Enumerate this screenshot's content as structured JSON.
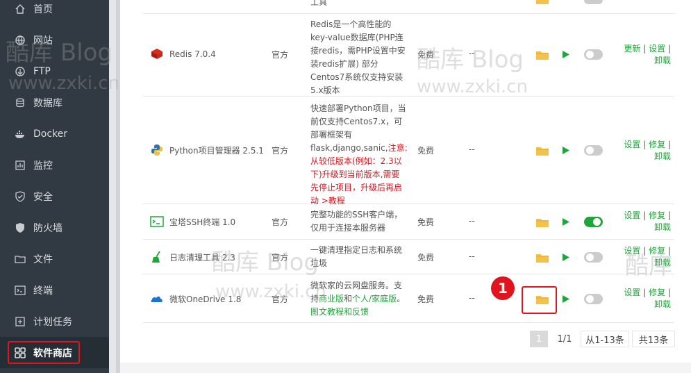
{
  "sidebar": {
    "items": [
      {
        "label": "首页",
        "icon": "home-icon"
      },
      {
        "label": "网站",
        "icon": "globe-icon"
      },
      {
        "label": "FTP",
        "icon": "ftp-icon"
      },
      {
        "label": "数据库",
        "icon": "database-icon"
      },
      {
        "label": "Docker",
        "icon": "docker-icon"
      },
      {
        "label": "监控",
        "icon": "monitor-icon"
      },
      {
        "label": "安全",
        "icon": "shield-icon"
      },
      {
        "label": "防火墙",
        "icon": "firewall-icon"
      },
      {
        "label": "文件",
        "icon": "folder-icon"
      },
      {
        "label": "终端",
        "icon": "terminal-icon"
      },
      {
        "label": "计划任务",
        "icon": "clock-icon"
      },
      {
        "label": "软件商店",
        "icon": "grid-icon"
      }
    ]
  },
  "table": {
    "top_partial": {
      "desc": "工具"
    },
    "rows": [
      {
        "name": "Redis 7.0.4",
        "developer": "官方",
        "desc_lines": [
          "Redis是一个高性能的",
          "key-value数据库(PHP连",
          "接redis，需PHP设置中安",
          "装redis扩展) 部分",
          "Centos7系统仅支持安装",
          "5.x版本"
        ],
        "price": "免费",
        "expire": "--",
        "toggle_on": false,
        "ops": [
          "更新",
          "设置",
          "卸载"
        ]
      },
      {
        "name": "Python项目管理器 2.5.1",
        "developer": "官方",
        "desc_lines": [
          "快速部署Python项目，当",
          "前仅支持Centos7.x，可",
          "部署框架有",
          "flask,django,sanic,"
        ],
        "desc_red_tail": "注意:",
        "desc_red_lines": [
          "从较低版本(例如：2.3以",
          "下)升级到当前版本,需要",
          "先停止项目，升级后再启",
          "动 >教程"
        ],
        "price": "免费",
        "expire": "--",
        "toggle_on": false,
        "ops": [
          "设置",
          "修复",
          "卸载"
        ]
      },
      {
        "name": "宝塔SSH终端 1.0",
        "developer": "官方",
        "desc_lines": [
          "完整功能的SSH客户端，",
          "仅用于连接本服务器"
        ],
        "price": "免费",
        "expire": "--",
        "toggle_on": true,
        "ops": [
          "设置",
          "修复",
          "卸载"
        ]
      },
      {
        "name": "日志清理工具 2.3",
        "developer": "官方",
        "desc_lines": [
          "一键清理指定日志和系统",
          "垃圾"
        ],
        "price": "免费",
        "expire": "--",
        "toggle_on": false,
        "ops": [
          "设置",
          "修复",
          "卸载"
        ]
      },
      {
        "name": "微软OneDrive 1.8",
        "developer": "官方",
        "desc_line1": "微软家的云网盘服务。支",
        "desc_line2_pre": "持",
        "desc_line2_g1": "商业版",
        "desc_line2_mid": "和",
        "desc_line2_g2": "个人/家庭版",
        "desc_line2_post": "。",
        "desc_line3": "图文教程和反馈",
        "price": "免费",
        "expire": "--",
        "toggle_on": false,
        "ops": [
          "设置",
          "修复",
          "卸载"
        ]
      }
    ]
  },
  "pager": {
    "current": "1",
    "pages": "1/1",
    "range": "从1-13条",
    "total": "共13条"
  },
  "callout": "1",
  "watermark": {
    "brand_cn": "酷库",
    "brand_en": "Blog",
    "url": "www.zxki.cn"
  },
  "colors": {
    "sidebar_bg": "#313a42",
    "accent_green": "#20a53a",
    "highlight_red": "#e0141e"
  }
}
